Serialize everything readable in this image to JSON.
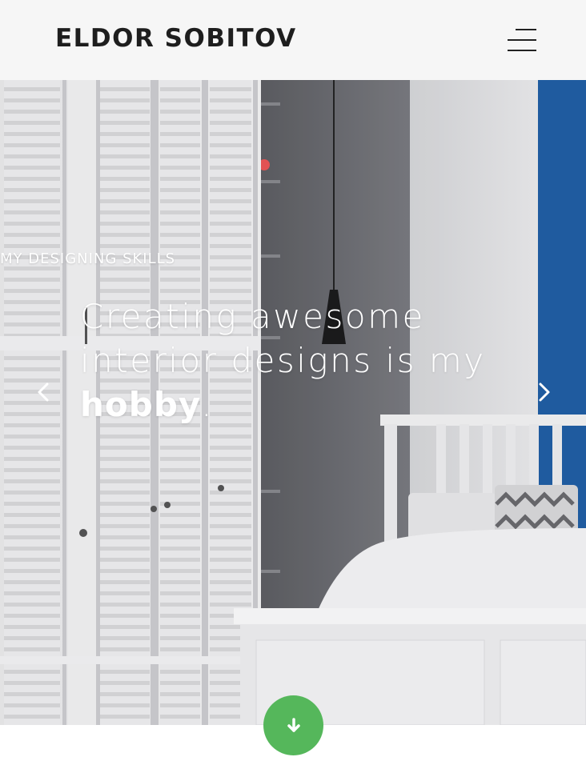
{
  "header": {
    "brand": "ELDOR SOBITOV",
    "menu_icon": "hamburger-menu-icon"
  },
  "hero": {
    "eyebrow": "MY DESIGNING SKILLS",
    "headline_line1": "Creating awesome",
    "headline_line2": "interior designs is my",
    "headline_emphasis": "hobby",
    "headline_end": ".",
    "prev_icon": "chevron-left-icon",
    "next_icon": "chevron-right-icon"
  },
  "scroll": {
    "icon": "arrow-down-icon",
    "color": "#55b75b"
  },
  "colors": {
    "header_bg": "#f6f6f6",
    "accent_blue": "#1f5fa6",
    "wall_gray": "#6f6f73"
  }
}
